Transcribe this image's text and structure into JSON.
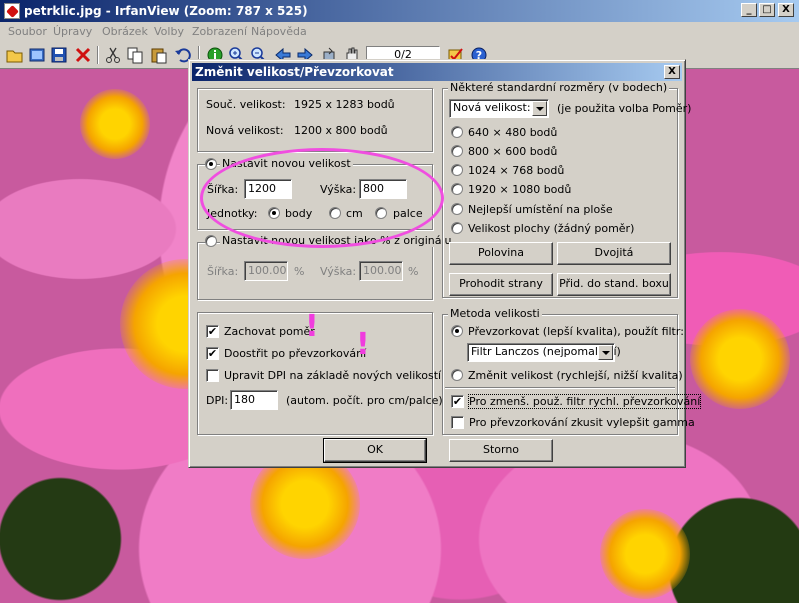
{
  "window": {
    "title": "petrklic.jpg - IrfanView (Zoom: 787 x 525)",
    "minimize": "_",
    "maximize": "□",
    "close": "X"
  },
  "menu": [
    "Soubor",
    "Úpravy",
    "Obrázek",
    "Volby",
    "Zobrazení",
    "Nápověda"
  ],
  "toolbar": {
    "page_field": "0/2",
    "icons": [
      "open-folder-icon",
      "slideshow-icon",
      "save-icon",
      "delete-icon",
      "cut-icon",
      "copy-icon",
      "paste-icon",
      "undo-icon",
      "info-icon",
      "zoom-in-icon",
      "zoom-out-icon",
      "previous-icon",
      "next-icon",
      "rotate-icon",
      "flip-icon",
      "hand-icon",
      "edit-checkbox-icon",
      "help-icon"
    ]
  },
  "dialog": {
    "title": "Změnit velikost/Převzorkovat",
    "close": "X",
    "current_size_label": "Souč. velikost:",
    "current_size_value": "1925  x  1283  bodů",
    "new_size_label": "Nová velikost:",
    "new_size_value": "1200  x  800  bodů",
    "set_new": {
      "label": "Nastavit novou velikost",
      "width_label": "Šířka:",
      "width_value": "1200",
      "height_label": "Výška:",
      "height_value": "800",
      "units_label": "Jednotky:",
      "unit_options": [
        "body",
        "cm",
        "palce"
      ],
      "unit_selected": "body"
    },
    "set_percent": {
      "label": "Nastavit novou velikost jako % z originálu",
      "width_label": "Šířka:",
      "width_value": "100.00",
      "height_label": "Výška:",
      "height_value": "100.00",
      "unit": "%"
    },
    "options": {
      "keep_ratio": "Zachovat poměr",
      "sharpen": "Doostřit po převzorkování",
      "adjust_dpi": "Upravit DPI na základě nových velikostí",
      "dpi_label": "DPI:",
      "dpi_value": "180",
      "dpi_note": "(autom. počít. pro cm/palce)"
    },
    "standard": {
      "group_label": "Některé standardní rozměry (v bodech)",
      "combo_value": "Nová  velikost:",
      "combo_note": "(je použita volba Poměr)",
      "sizes": [
        "640 × 480 bodů",
        "800 × 600 bodů",
        "1024 × 768 bodů",
        "1920 × 1080 bodů",
        "Nejlepší umístění na ploše",
        "Velikost plochy (žádný poměr)"
      ],
      "btn_half": "Polovina",
      "btn_double": "Dvojitá",
      "btn_swap": "Prohodit strany",
      "btn_add": "Přid. do stand. boxu"
    },
    "method": {
      "group_label": "Metoda velikosti",
      "resample_label": "Převzorkovat (lepší kvalita), použít filtr:",
      "filter_value": "Filtr Lanczos (nejpomalejší)",
      "resize_label": "Změnit velikost (rychlejší, nižší kvalita)",
      "fast_filter": "Pro zmenš. použ. filtr rychl. převzorkování",
      "gamma": "Pro převzorkování zkusit vylepšit gamma"
    },
    "ok": "OK",
    "cancel": "Storno"
  },
  "annotation": {
    "mark1": "!",
    "mark2": "!",
    "color": "#f04ee0"
  }
}
